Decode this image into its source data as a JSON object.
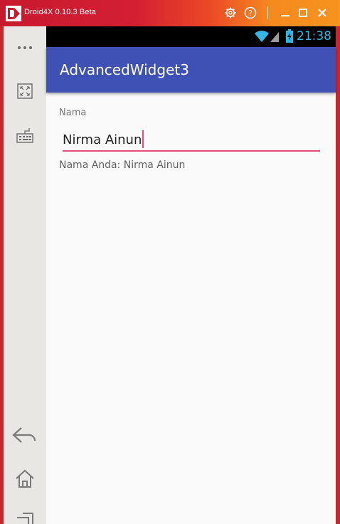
{
  "window": {
    "title": "Droid4X 0.10.3 Beta",
    "colors": {
      "frame": "#c9262c",
      "title_start": "#c8192e",
      "title_end": "#f7931e"
    },
    "controls": [
      "settings-icon",
      "help-icon",
      "minimize-icon",
      "maximize-icon",
      "close-icon"
    ]
  },
  "sidebar": {
    "items": [
      "more-icon",
      "fullscreen-icon",
      "keyboard-icon",
      "back-icon",
      "home-icon",
      "recents-icon"
    ]
  },
  "android": {
    "status_bar": {
      "time": "21:38",
      "icons": [
        "wifi-icon",
        "signal-icon",
        "battery-icon"
      ]
    },
    "app_bar": {
      "title": "AdvancedWidget3",
      "color": "#3f51b5"
    },
    "form": {
      "label": "Nama",
      "input_value": "Nirma Ainun",
      "accent": "#e8487a",
      "result": "Nama Anda: Nirma Ainun"
    }
  }
}
